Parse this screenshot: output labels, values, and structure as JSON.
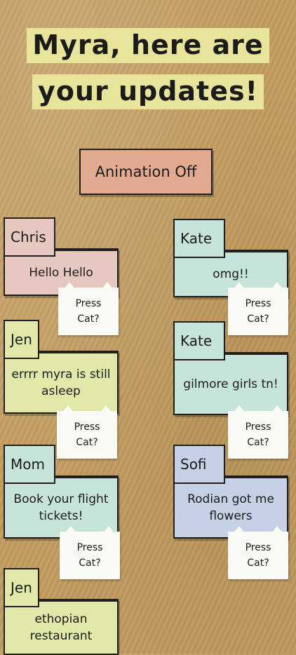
{
  "header": {
    "line1": "Myra, here are",
    "line2": "your updates!"
  },
  "animation_button": {
    "label": "Animation Off"
  },
  "cards": [
    {
      "sender": "Chris",
      "message": "Hello Hello",
      "cat": [
        "Press",
        "Cat?"
      ]
    },
    {
      "sender": "Kate",
      "message": "omg!!",
      "cat": [
        "Press",
        "Cat?"
      ]
    },
    {
      "sender": "Jen",
      "message": "errrr myra is still asleep",
      "cat": [
        "Press",
        "Cat?"
      ]
    },
    {
      "sender": "Kate",
      "message": "gilmore girls tn!",
      "cat": [
        "Press",
        "Cat?"
      ]
    },
    {
      "sender": "Mom",
      "message": "Book your flight tickets!",
      "cat": [
        "Press",
        "Cat?"
      ]
    },
    {
      "sender": "Sofi",
      "message": "Rodian got me flowers",
      "cat": [
        "Press",
        "Cat?"
      ]
    },
    {
      "sender": "Jen",
      "message": "ethopian restaurant"
    }
  ],
  "colors": {
    "pink": "#e7c8c0",
    "mint": "#c7e4da",
    "lime": "#e1e8a9",
    "blue": "#c6d1e6",
    "title_highlight": "#e8e49a",
    "button": "#e2ab90"
  }
}
